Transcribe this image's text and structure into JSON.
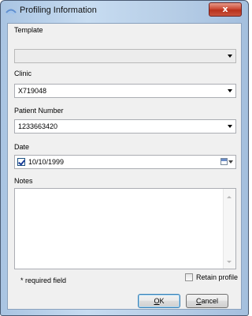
{
  "window": {
    "title": "Profiling Information",
    "close_label": "x"
  },
  "form": {
    "template": {
      "label": "Template",
      "value": ""
    },
    "clinic": {
      "label": "Clinic",
      "value": "X719048"
    },
    "patient_number": {
      "label": "Patient Number",
      "value": "1233663420"
    },
    "date": {
      "label": "Date",
      "value": "10/10/1999",
      "checked": true
    },
    "notes": {
      "label": "Notes",
      "value": ""
    }
  },
  "footer": {
    "required_note": "* required field",
    "retain_profile": {
      "label": "Retain profile",
      "checked": false
    },
    "ok_button": {
      "access_key": "O",
      "rest": "K"
    },
    "cancel_button": {
      "access_key": "C",
      "rest": "ancel"
    }
  },
  "icons": {
    "app": "profiling-app-icon",
    "close": "close-icon",
    "dropdown": "chevron-down-icon",
    "calendar": "calendar-icon"
  }
}
